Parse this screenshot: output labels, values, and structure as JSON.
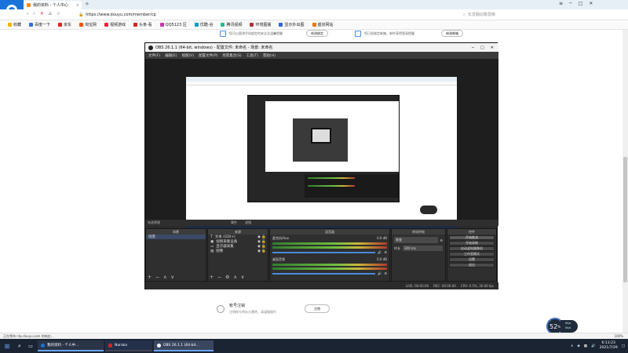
{
  "browser": {
    "tab_title": "我的资料 - 个人中心",
    "new_tab": "+",
    "url": "https://www.douyu.com/member/cp",
    "search_placeholder": "长发翻动着蔷薇",
    "favorites": [
      "收藏",
      "百度一下",
      "京东",
      "淘宝网",
      "视频游戏",
      "头条·看",
      "QQ5123 区",
      "优酷·谷",
      "腾讯视频",
      "环境图版",
      "显示外出图",
      "盛京网站"
    ]
  },
  "page": {
    "note1": "您可以更改手机绑定的安全及温馨提醒",
    "btn1": "修改绑定",
    "note2": "您已经绑定邮箱，邮件获得登录提醒",
    "btn2": "修改邮箱",
    "logout_title": "帐号注销",
    "logout_desc": "注销帐号将永久删除，请谨慎操作",
    "logout_button": "注销"
  },
  "obs": {
    "title": "OBS 26.1.1 (64-bit, windows) - 配置文件: 未命名 - 场景: 未命名",
    "menu": [
      "文件(F)",
      "编辑(E)",
      "视图(V)",
      "配置文件(P)",
      "场景集合(S)",
      "工具(T)",
      "帮助(H)"
    ],
    "scene_panel": "场景",
    "scene_item": "场景",
    "source_panel": "来源",
    "sources": [
      "文本 (GDI+)",
      "视频采集设备",
      "显示器采集",
      "图像"
    ],
    "audio_panel": "混音器",
    "audio": [
      {
        "name": "麦克风/Aux",
        "level": "0.0 dB"
      },
      {
        "name": "桌面音频",
        "level": "0.0 dB"
      }
    ],
    "transition_panel": "转场特效",
    "transition_type": "渐变",
    "duration_label": "时长",
    "duration_value": "300 ms",
    "controls_panel": "控件",
    "controls": [
      "开始推流",
      "开始录制",
      "启动虚拟摄像机",
      "工作室模式",
      "设置",
      "退出"
    ],
    "not_selected": "未选择源",
    "props_btn": "属性",
    "filter_btn": "滤镜",
    "status": {
      "live": "LIVE: 00:00:00",
      "rec": "REC: 00:00:00",
      "cpu": "CPU: 0.5%, 30.00 fps"
    }
  },
  "statusbar": {
    "text": "正在等待 ntp.douyu.com 的响应...",
    "zoom": "100%"
  },
  "speed": {
    "value": "52",
    "unit": "%",
    "up": "0k/s",
    "down": "0k/s"
  },
  "taskbar": {
    "apps": [
      "我的资料 - 个人中...",
      "Naraka",
      "OBS 26.1.1 (64-bit..."
    ],
    "time": "6:13:23",
    "date": "2021/7/29"
  },
  "colors": {
    "accent": "#1a73d9",
    "obs_bg": "#2b2b2b",
    "taskbar": "#1b2433"
  }
}
